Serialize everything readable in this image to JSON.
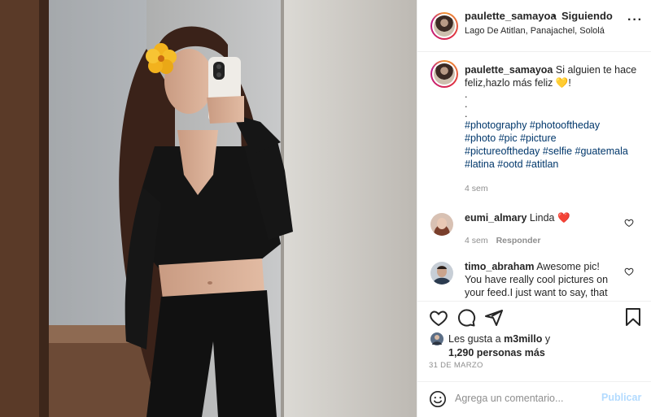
{
  "post": {
    "author": "paulette_samayoa",
    "follow_status": "Siguiendo",
    "location": "Lago De Atitlan, Panajachel, Sololá",
    "caption_text": "Si alguien te hace feliz,hazlo más feliz 💛!",
    "caption_dots": [
      ".",
      ".",
      "."
    ],
    "hashtags_lines": [
      "#photography #photooftheday",
      "#photo #pic #picture",
      "#pictureoftheday #selfie #guatemala",
      "#latina #ootd #atitlan"
    ],
    "caption_age": "4 sem"
  },
  "comments": [
    {
      "user": "eumi_almary",
      "text": "Linda ❤️",
      "age": "4 sem",
      "reply_label": "Responder"
    },
    {
      "user": "timo_abraham",
      "text": "Awesome pic! You have really cool pictures on your feed.I just want to say, that"
    }
  ],
  "likes": {
    "prefix": "Les gusta a",
    "user": "m3millo",
    "connector": "y",
    "count_text": "1,290 personas más"
  },
  "date": "31 DE MARZO",
  "add_comment": {
    "placeholder": "Agrega un comentario...",
    "post_label": "Publicar"
  },
  "colors": {
    "hashtag": "#00376b",
    "publish_disabled": "#b3dbff",
    "heart": "#ed4956"
  }
}
